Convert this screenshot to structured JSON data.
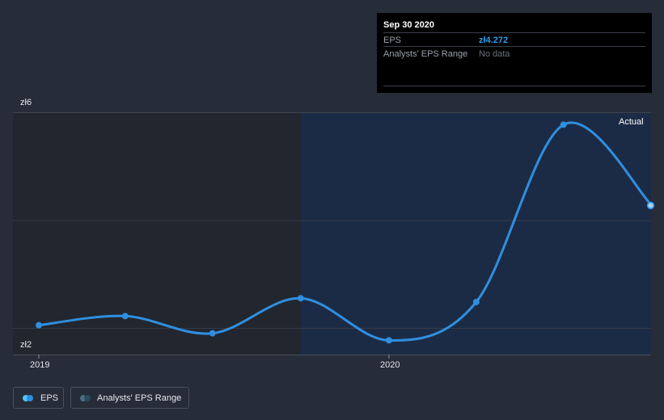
{
  "tooltip": {
    "date": "Sep 30 2020",
    "eps_label": "EPS",
    "eps_value": "zł4.272",
    "range_label": "Analysts' EPS Range",
    "range_value": "No data"
  },
  "y_axis": {
    "top_label": "zł6",
    "bottom_label": "zł2"
  },
  "x_axis": {
    "labels": [
      "2019",
      "2020"
    ]
  },
  "actual_label": "Actual",
  "legend": {
    "eps_label": "EPS",
    "range_label": "Analysts' EPS Range"
  },
  "colors": {
    "background": "#262c38",
    "eps_line": "#2f8fe0",
    "actual_region": "#1c2b45",
    "past_region": "#22262e"
  },
  "chart_data": {
    "type": "line",
    "series": [
      {
        "name": "EPS",
        "x": [
          "2018-12-31",
          "2019-03-31",
          "2019-06-30",
          "2019-09-30",
          "2019-12-31",
          "2020-03-31",
          "2020-06-30",
          "2020-09-30"
        ],
        "values": [
          2.05,
          2.22,
          1.9,
          2.55,
          1.77,
          2.48,
          5.77,
          4.272
        ]
      }
    ],
    "ylim": [
      2,
      6
    ],
    "x_ticks": [
      "2019",
      "2020"
    ],
    "actual_from": "2019-09-30",
    "grid": true,
    "legend_placement": "bottom-left"
  }
}
